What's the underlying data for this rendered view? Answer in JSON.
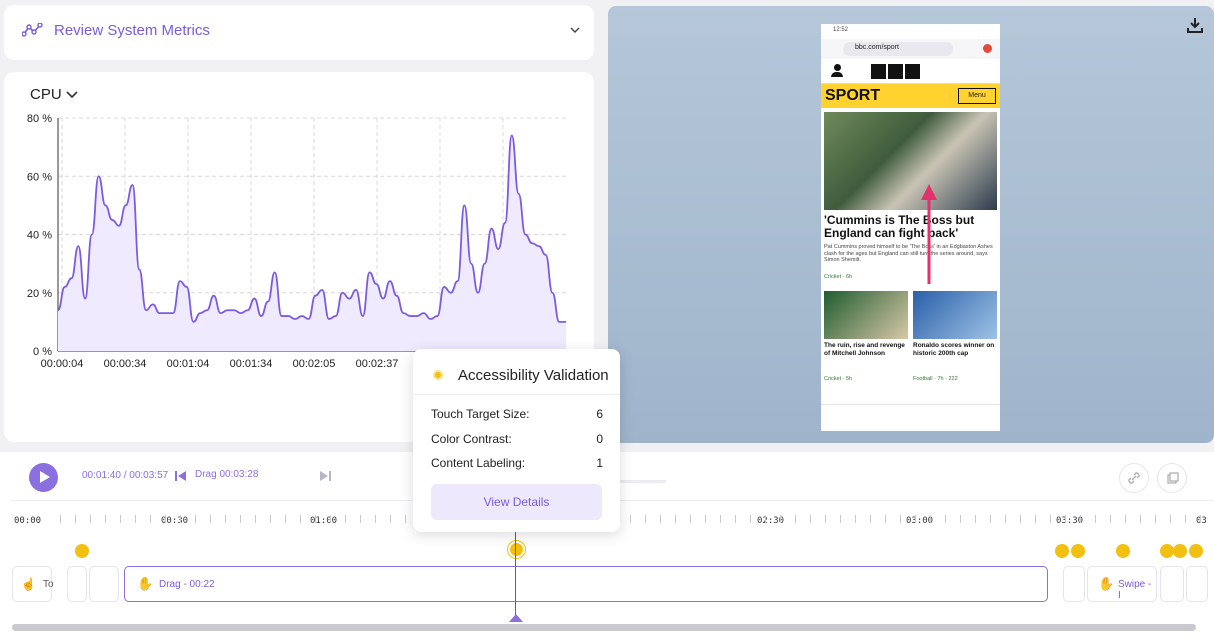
{
  "header": {
    "title": "Review System Metrics"
  },
  "chart": {
    "dropdown_label": "CPU"
  },
  "chart_data": {
    "type": "area",
    "title": "CPU",
    "y_ticks": [
      "80 %",
      "60 %",
      "40 %",
      "20 %",
      "0 %"
    ],
    "x_ticks": [
      "00:00:04",
      "00:00:34",
      "00:01:04",
      "00:01:34",
      "00:02:05",
      "00:02:37"
    ],
    "ylim": [
      0,
      80
    ],
    "grid": true,
    "y_values": [
      14,
      22,
      25,
      36,
      18,
      40,
      60,
      50,
      45,
      43,
      50,
      57,
      28,
      14,
      16,
      13,
      13,
      13,
      24,
      22,
      10,
      13,
      14,
      19,
      13,
      14,
      14,
      13,
      14,
      18,
      12,
      17,
      27,
      12,
      12,
      11,
      12,
      11,
      19,
      21,
      11,
      12,
      20,
      18,
      21,
      12,
      27,
      23,
      18,
      24,
      19,
      13,
      12,
      12,
      13,
      11,
      12,
      22,
      20,
      24,
      50,
      30,
      20,
      30,
      42,
      35,
      44,
      74,
      54,
      40,
      37,
      36,
      33,
      20,
      10,
      10
    ],
    "color": "#7b5ce0"
  },
  "phone": {
    "status_time": "12:52",
    "url": "bbc.com/sport",
    "brand": "BBC",
    "section": "SPORT",
    "menu": "Menu",
    "headline": "'Cummins is The Boss but England can fight back'",
    "summary": "Pat Cummins proved himself to be 'The Boss' in an Edgbaston Ashes clash for the ages but England can still turn the series around, says Simon Shemilt.",
    "tag1": "Cricket · 6h",
    "story2": "The ruin, rise and revenge of Mitchell Johnson",
    "story2_tag": "Cricket · 5h",
    "story3": "Ronaldo scores winner on historic 200th cap",
    "story3_tag": "Football · 7h · 222"
  },
  "timeline": {
    "time": "00:01:40 / 00:03:57",
    "prev_label": "Drag 00:03:28",
    "ruler": [
      "00:00",
      "00:30",
      "01:00",
      "02:30",
      "03:00",
      "03:30",
      "03"
    ],
    "segments": [
      {
        "label": "To",
        "icon": "tap-icon"
      },
      {
        "label": "Drag - 00:22",
        "icon": "drag-icon"
      },
      {
        "label": "Swipe - I",
        "icon": "swipe-icon"
      }
    ]
  },
  "popup": {
    "title": "Accessibility Validation",
    "rows": [
      {
        "label": "Touch Target Size:",
        "value": "6"
      },
      {
        "label": "Color Contrast:",
        "value": "0"
      },
      {
        "label": "Content Labeling:",
        "value": "1"
      }
    ],
    "button": "View Details"
  }
}
